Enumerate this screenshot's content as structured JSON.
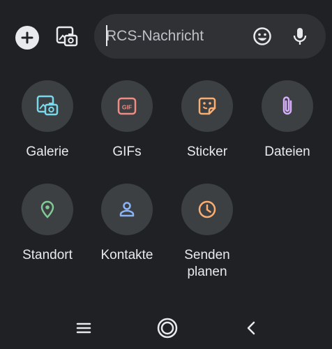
{
  "compose": {
    "placeholder": "RCS-Nachricht",
    "value": ""
  },
  "top_bar": {
    "icons": [
      "plus-icon",
      "gallery-camera-icon",
      "emoji-icon",
      "microphone-icon"
    ]
  },
  "attachments": [
    {
      "label": "Galerie",
      "icon": "gallery-icon",
      "color": "#78d9ec"
    },
    {
      "label": "GIFs",
      "icon": "gif-icon",
      "color": "#f28b82"
    },
    {
      "label": "Sticker",
      "icon": "sticker-icon",
      "color": "#fcad70"
    },
    {
      "label": "Dateien",
      "icon": "paperclip-icon",
      "color": "#d7aefb"
    },
    {
      "label": "Standort",
      "icon": "location-pin-icon",
      "color": "#81c995"
    },
    {
      "label": "Kontakte",
      "icon": "contact-person-icon",
      "color": "#8ab4f8"
    },
    {
      "label": "Senden\nplanen",
      "icon": "clock-icon",
      "color": "#fcad70"
    }
  ],
  "nav_bar": {
    "icons": [
      "recent-apps-icon",
      "home-icon",
      "back-icon"
    ]
  }
}
